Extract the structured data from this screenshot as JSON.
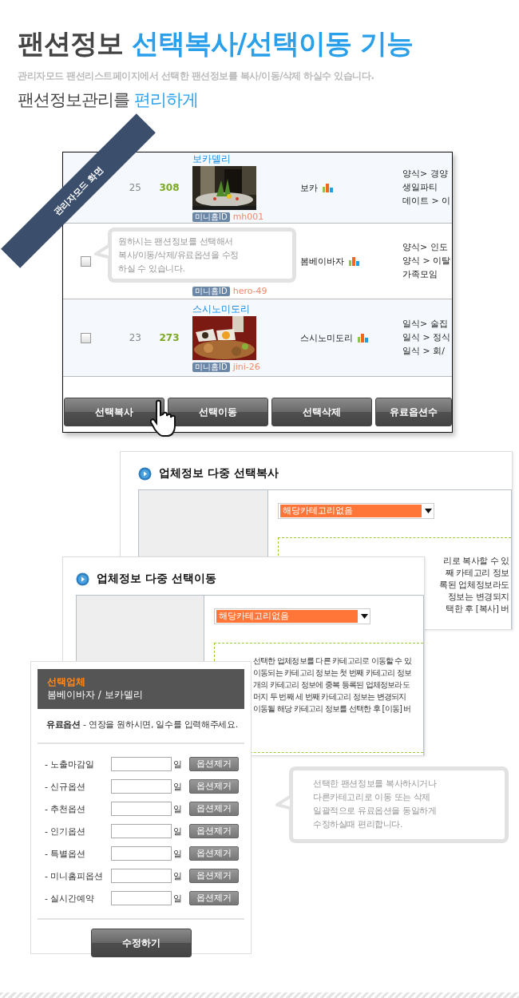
{
  "header": {
    "title": "팬션정보",
    "title_accent": "선택복사/선택이동 기능",
    "subtitle": "관리자모드 팬션리스트페이지에서 선택한 팬션정보를 복사/이동/삭제 하실수 있습니다.",
    "tagline": "팬션정보관리를",
    "tagline_accent": "편리하게"
  },
  "admin_list": {
    "ribbon": "관리자모드 화면",
    "rows": [
      {
        "title": "보카델리",
        "rank": "25",
        "score": "308",
        "photo": {
          "kind": "picture"
        },
        "badge": "미니홈ID",
        "mini_id": "mh001",
        "name": "보카",
        "categories": [
          "양식> 경양",
          "생일파티",
          "데이트 > 이"
        ]
      },
      {
        "checked": false,
        "badge": "미니홈ID",
        "mini_id": "hero-49",
        "name": "봄베이바자",
        "categories": [
          "양식> 인도",
          "양식 > 이탈",
          "가족모임"
        ]
      },
      {
        "checked": false,
        "title": "스시노미도리",
        "rank": "23",
        "score": "273",
        "photo": {
          "kind": "picture"
        },
        "badge": "미니홈ID",
        "mini_id": "jini-26",
        "name": "스시노미도리",
        "categories": [
          "일식> 술집",
          "일식 > 정식",
          "일식 > 회/"
        ]
      }
    ],
    "tooltip": "원하시는 팬션정보를 선택해서\n복사/이동/삭제/유료옵션을 수정\n하실 수 있습니다.",
    "buttons": [
      "선택복사",
      "선택이동",
      "선택삭제",
      "유료옵션수"
    ]
  },
  "copy_panel": {
    "title": "업체정보 다중 선택복사",
    "select": "해당카테고리없음",
    "note_fragments": [
      "리로 복사할 수 있",
      "째 카테고리 정보",
      "록된 업체정보라도",
      "정보는 변경되지",
      "택한 후 [복사] 버"
    ]
  },
  "move_panel": {
    "title": "업체정보 다중 선택이동",
    "select": "해당카테고리없음",
    "note_fragments": [
      "선택한 업체정보를 다른 카테고리로 이동할 수 있",
      "이동되는 카테고리 정보는 첫 번째 카테고리 정보",
      "개의 카테고리 정보에 중복 등록된 업체정보라도",
      "머지 두 번째 세 번째 카테고리 정보는 변경되지",
      "이동될 해당 카테고리 정보를 선택한 후 [이동] 버"
    ]
  },
  "option_form": {
    "header_label": "선택업체",
    "companies": "봄베이바자 / 보카델리",
    "note": "**유료옵션** - 연장을 원하시면, 일수를 입력해주세요.",
    "options": [
      {
        "label": "- 노출마감일",
        "unit": "일",
        "button": "옵션제거"
      },
      {
        "label": "- 신규옵션",
        "unit": "일",
        "button": "옵션제거"
      },
      {
        "label": "- 추천옵션",
        "unit": "일",
        "button": "옵션제거"
      },
      {
        "label": "- 인기옵션",
        "unit": "일",
        "button": "옵션제거"
      },
      {
        "label": "- 특별옵션",
        "unit": "일",
        "button": "옵션제거"
      },
      {
        "label": "- 미니홈피옵션",
        "unit": "일",
        "button": "옵션제거"
      },
      {
        "label": "- 실시간예약",
        "unit": "일",
        "button": "옵션제거"
      }
    ],
    "submit": "수정하기"
  },
  "info_tooltip": "선택한 팬션정보를 복사하시거나\n다른카테고리로 이동 또는 삭제\n일괄적으로 유료옵션을 동일하게\n수정하실때 편리합니다."
}
